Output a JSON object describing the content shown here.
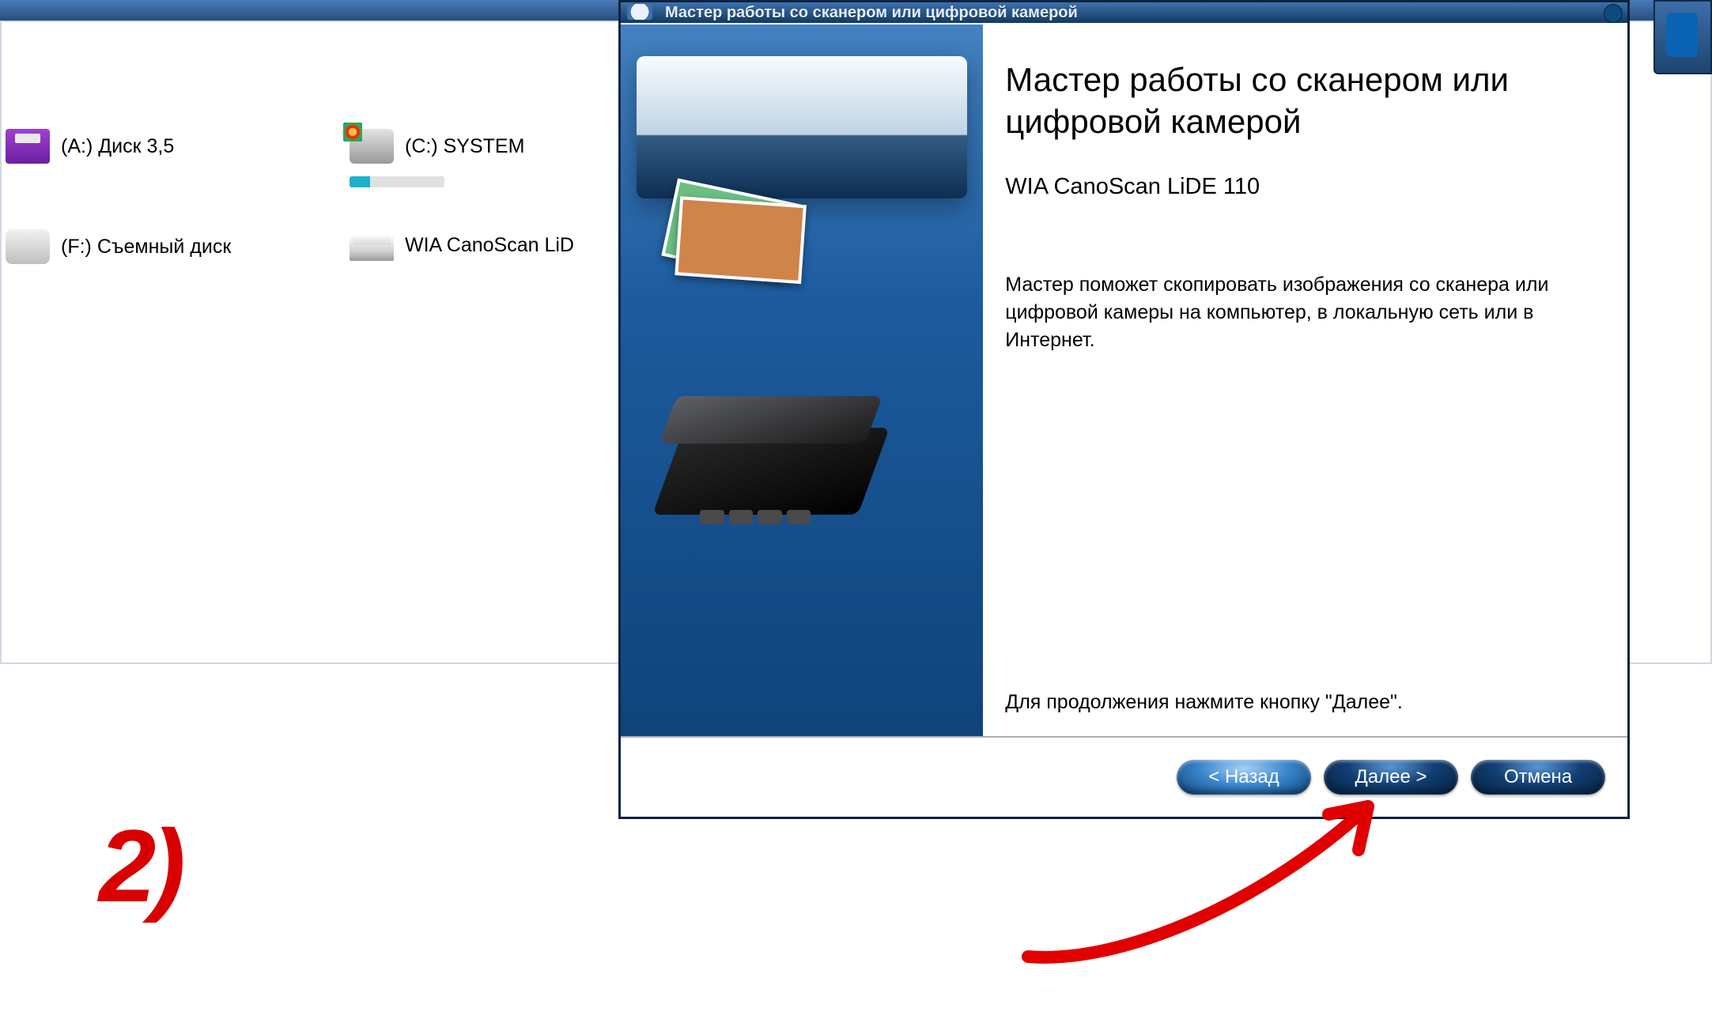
{
  "explorer": {
    "drives": {
      "floppy": "(A:) Диск 3,5",
      "system": "(C:) SYSTEM",
      "removable": "(F:) Съемный диск",
      "scanner": "WIA CanoScan LiD"
    }
  },
  "dialog": {
    "title_bar": "Мастер работы со сканером или цифровой камерой",
    "heading": "Мастер работы со сканером или цифровой камерой",
    "device_name": "WIA CanoScan LiDE 110",
    "description": "Мастер поможет скопировать изображения со сканера или цифровой камеры на компьютер, в локальную сеть или в Интернет.",
    "continue_hint": "Для продолжения нажмите кнопку \"Далее\".",
    "buttons": {
      "back": "< Назад",
      "next": "Далее >",
      "cancel": "Отмена"
    }
  },
  "annotation": {
    "step": "2)"
  }
}
